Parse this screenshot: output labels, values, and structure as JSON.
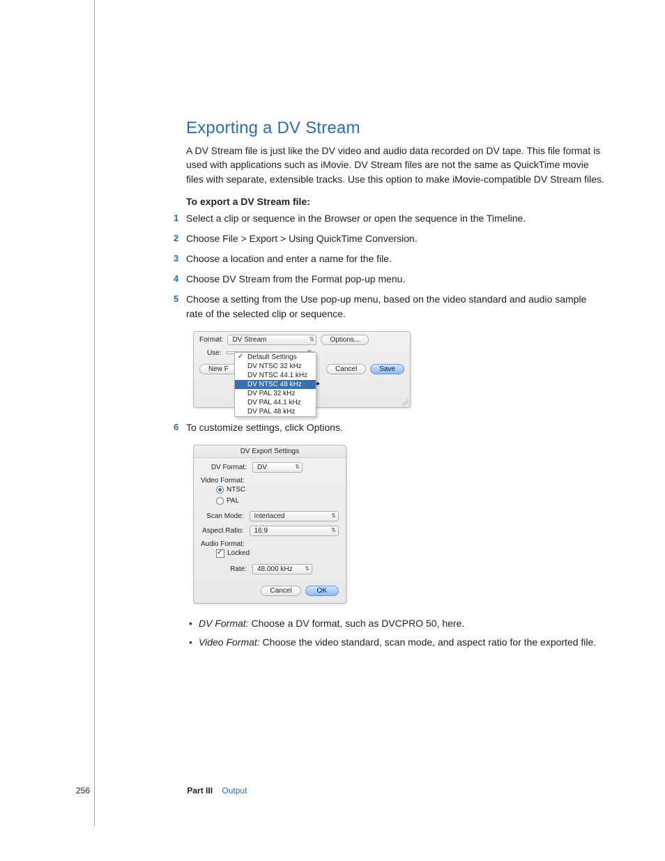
{
  "heading": "Exporting a DV Stream",
  "intro": "A DV Stream file is just like the DV video and audio data recorded on DV tape. This file format is used with applications such as iMovie. DV Stream files are not the same as QuickTime movie files with separate, extensible tracks. Use this option to make iMovie-compatible DV Stream files.",
  "subhead": "To export a DV Stream file:",
  "steps": [
    "Select a clip or sequence in the Browser or open the sequence in the Timeline.",
    "Choose File > Export > Using QuickTime Conversion.",
    "Choose a location and enter a name for the file.",
    "Choose DV Stream from the Format pop-up menu.",
    "Choose a setting from the Use pop-up menu, based on the video standard and audio sample rate of the selected clip or sequence.",
    "To customize settings, click Options."
  ],
  "dialog1": {
    "format_label": "Format:",
    "format_value": "DV Stream",
    "options_btn": "Options...",
    "use_label": "Use:",
    "newfolder_btn": "New F",
    "cancel_btn": "Cancel",
    "save_btn": "Save",
    "dropdown": {
      "checked": "Default Settings",
      "items": [
        "DV NTSC 32 kHz",
        "DV NTSC 44.1 kHz",
        "DV NTSC 48 kHz",
        "DV PAL 32 kHz",
        "DV PAL 44.1 kHz",
        "DV PAL 48 kHz"
      ],
      "highlight_index": 2
    }
  },
  "dialog2": {
    "title": "DV Export Settings",
    "dvformat_label": "DV Format:",
    "dvformat_value": "DV",
    "videofmt_label": "Video Format:",
    "ntsc": "NTSC",
    "pal": "PAL",
    "scanmode_label": "Scan Mode:",
    "scanmode_value": "Interlaced",
    "aspect_label": "Aspect Ratio:",
    "aspect_value": "16:9",
    "audiofmt_label": "Audio Format:",
    "locked": "Locked",
    "rate_label": "Rate:",
    "rate_value": "48.000 kHz",
    "cancel_btn": "Cancel",
    "ok_btn": "OK"
  },
  "bullets": [
    {
      "term": "DV Format:",
      "text": "  Choose a DV format, such as DVCPRO 50, here."
    },
    {
      "term": "Video Format:",
      "text": "  Choose the video standard, scan mode, and aspect ratio for the exported file."
    }
  ],
  "footer": {
    "page": "256",
    "part": "Part III",
    "part_name": "Output"
  }
}
